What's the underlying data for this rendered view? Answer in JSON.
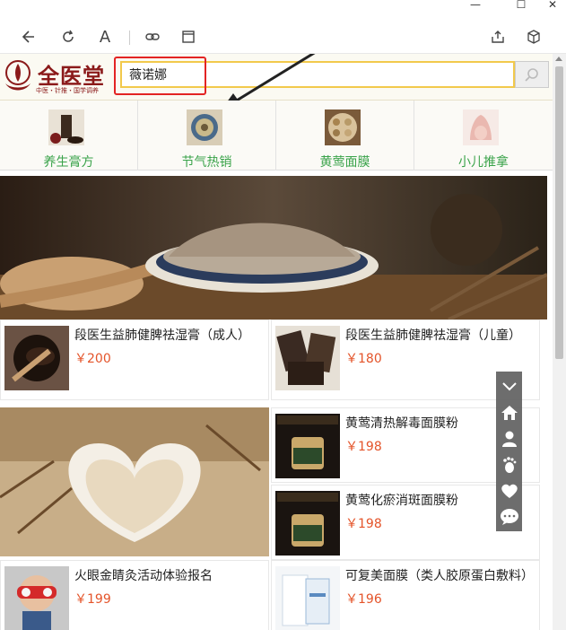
{
  "window": {
    "minimize": "—",
    "maximize": "☐",
    "close": "✕"
  },
  "toolbar": {
    "back_icon": "back-arrow-icon",
    "refresh_icon": "refresh-icon",
    "font_label": "A",
    "link_icon": "link-icon",
    "window_icon": "window-icon",
    "share_icon": "share-icon",
    "cube_icon": "cube-icon"
  },
  "logo": {
    "title": "全医堂",
    "subtitle": "中医・针推・国学调养"
  },
  "search": {
    "value": "薇诺娜"
  },
  "categories": [
    {
      "label": "养生膏方"
    },
    {
      "label": "节气热销"
    },
    {
      "label": "黄莺面膜"
    },
    {
      "label": "小儿推拿"
    }
  ],
  "products": [
    {
      "title": "段医生益肺健脾祛湿膏（成人）",
      "price": "￥200"
    },
    {
      "title": "段医生益肺健脾祛湿膏（儿童）",
      "price": "￥180"
    },
    {
      "title": "黄莺清热解毒面膜粉",
      "price": "￥198"
    },
    {
      "title": "黄莺化瘀消斑面膜粉",
      "price": "￥198"
    },
    {
      "title": "火眼金睛灸活动体验报名",
      "price": "￥199"
    },
    {
      "title": "可复美面膜（类人胶原蛋白敷料）",
      "price": "￥196"
    }
  ],
  "colors": {
    "accent_green": "#3aa34a",
    "price_orange": "#e4542a",
    "highlight_red": "#e32424",
    "search_border": "#f2c94c"
  },
  "floatbar": [
    "chevron-down-icon",
    "home-icon",
    "user-icon",
    "footprint-icon",
    "heart-icon",
    "chat-icon"
  ]
}
